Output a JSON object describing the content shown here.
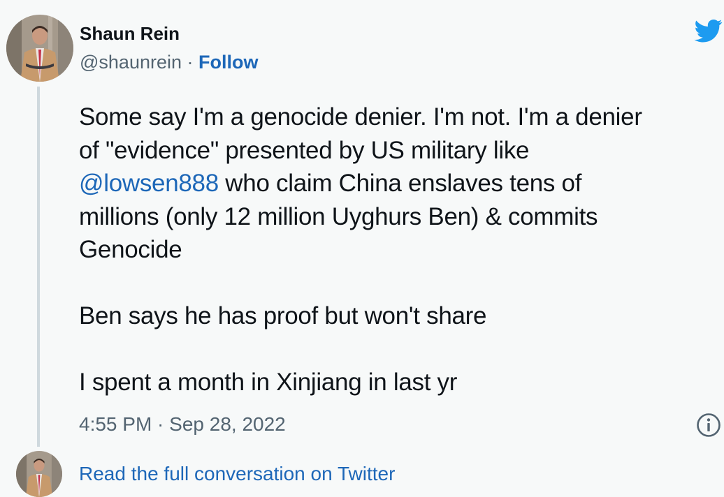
{
  "author": {
    "name": "Shaun Rein",
    "handle": "@shaunrein",
    "separator": "·",
    "follow_label": "Follow"
  },
  "tweet": {
    "lines_p1": [
      "Some say I'm a genocide denier. I'm not. I'm a denier",
      "of \"evidence\" presented by US military like"
    ],
    "mention": "@lowsen888",
    "mention_tail": " who claim China enslaves tens of",
    "lines_p1_end": [
      "millions (only 12 million Uyghurs Ben) & commits",
      "Genocide"
    ],
    "paragraph2": "Ben says he has proof but won't share",
    "paragraph3": "I spent a month in Xinjiang in last yr"
  },
  "timestamp": "4:55 PM · Sep 28, 2022",
  "footer": {
    "read_more": "Read the full conversation on Twitter"
  },
  "icons": {
    "brand": "twitter-bird-icon",
    "info": "info-icon"
  },
  "colors": {
    "background": "#f7f9f9",
    "text": "#0f1419",
    "secondary": "#536471",
    "link": "#1d67b8",
    "twitter_blue": "#1d9bf0",
    "thread_line": "#cfd9de"
  }
}
